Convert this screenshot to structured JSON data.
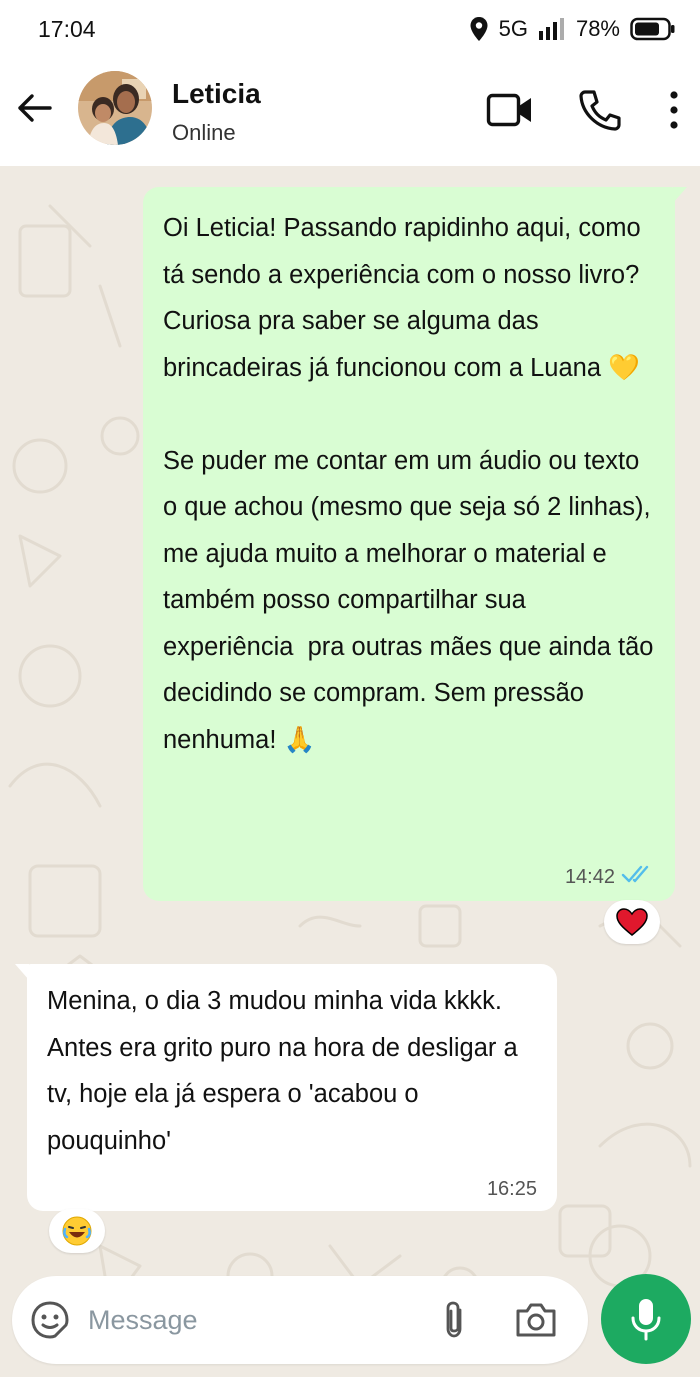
{
  "status_bar": {
    "time": "17:04",
    "network": "5G",
    "battery": "78%",
    "icons": [
      "location-icon",
      "signal-icon",
      "battery-icon"
    ]
  },
  "header": {
    "contact_name": "Leticia",
    "contact_status": "Online",
    "icons": [
      "back-arrow-icon",
      "video-call-icon",
      "phone-icon",
      "more-vert-icon"
    ]
  },
  "messages": [
    {
      "direction": "outgoing",
      "text": "Oi Leticia! Passando rapidinho aqui, como tá sendo a experiência com o nosso livro? Curiosa pra saber se alguma das brincadeiras já funcionou com a Luana 💛\n\nSe puder me contar em um áudio ou texto o que achou (mesmo que seja só 2 linhas), me ajuda muito a melhorar o material e também posso compartilhar sua experiência  pra outras mães que ainda tão decidindo se compram. Sem pressão nenhuma! 🙏",
      "time": "14:42",
      "status": "read",
      "reaction": "❤️"
    },
    {
      "direction": "incoming",
      "text": "Menina, o dia 3 mudou minha vida kkkk. Antes era grito puro na hora de desligar a tv, hoje ela já espera o 'acabou o pouquinho'",
      "time": "16:25",
      "reaction": "😂"
    }
  ],
  "composer": {
    "placeholder": "Message",
    "value": "",
    "icons": [
      "sticker-icon",
      "attach-icon",
      "camera-icon",
      "mic-icon"
    ]
  },
  "colors": {
    "chat_background": "#efeae2",
    "outgoing_bubble": "#d9fdd3",
    "incoming_bubble": "#ffffff",
    "read_ticks": "#53bdeb",
    "mic_button": "#1daa61"
  }
}
